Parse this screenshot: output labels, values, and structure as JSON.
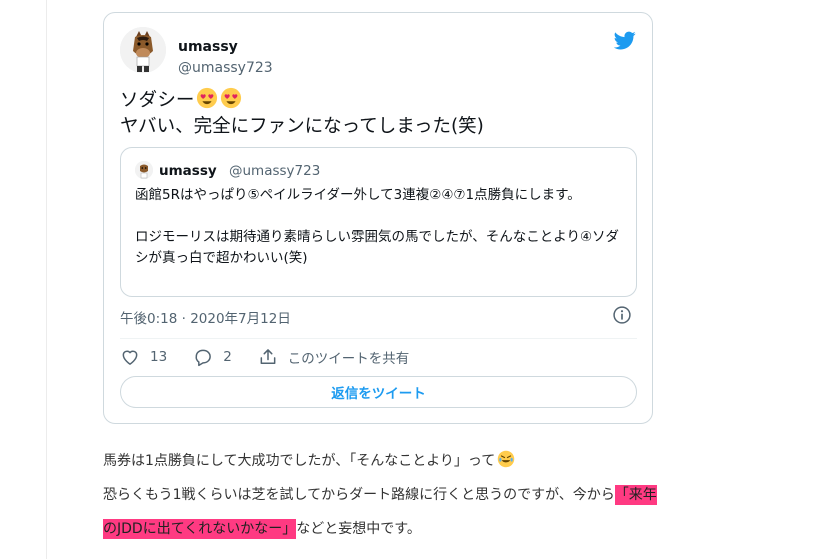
{
  "tweet": {
    "author_name": "umassy",
    "author_handle": "@umassy723",
    "text_line1": "ソダシー",
    "text_line2": "ヤバい、完全にファンになってしまった(笑)",
    "emoji": [
      "heart-eyes-emoji",
      "heart-eyes-emoji"
    ],
    "timestamp": "午後0:18 · 2020年7月12日",
    "likes": "13",
    "replies": "2",
    "share_label": "このツイートを共有",
    "reply_button_label": "返信をツイート"
  },
  "quote": {
    "author_name": "umassy",
    "author_handle": "@umassy723",
    "para1": "函館5Rはやっぱり⑤ペイルライダー外して3連複②④⑦1点勝負にします。",
    "para2": "ロジモーリスは期待通り素晴らしい雰囲気の馬でしたが、そんなことより④ソダシが真っ白で超かわいい(笑)"
  },
  "article": {
    "line1": "馬券は1点勝負にして大成功でしたが、「そんなことより」って",
    "line2_plain": "恐らくもう1戦くらいは芝を試してからダート路線に行くと思うのですが、今から",
    "line2_highlight": "「来年",
    "line3_highlight": "のJDDに出てくれないかなー」",
    "line3_plain": "などと妄想中です。",
    "emoji": "rofl-emoji"
  },
  "colors": {
    "twitter_blue": "#1d9bf0",
    "highlight": "#ff3a82",
    "secondary_text": "#536471"
  }
}
